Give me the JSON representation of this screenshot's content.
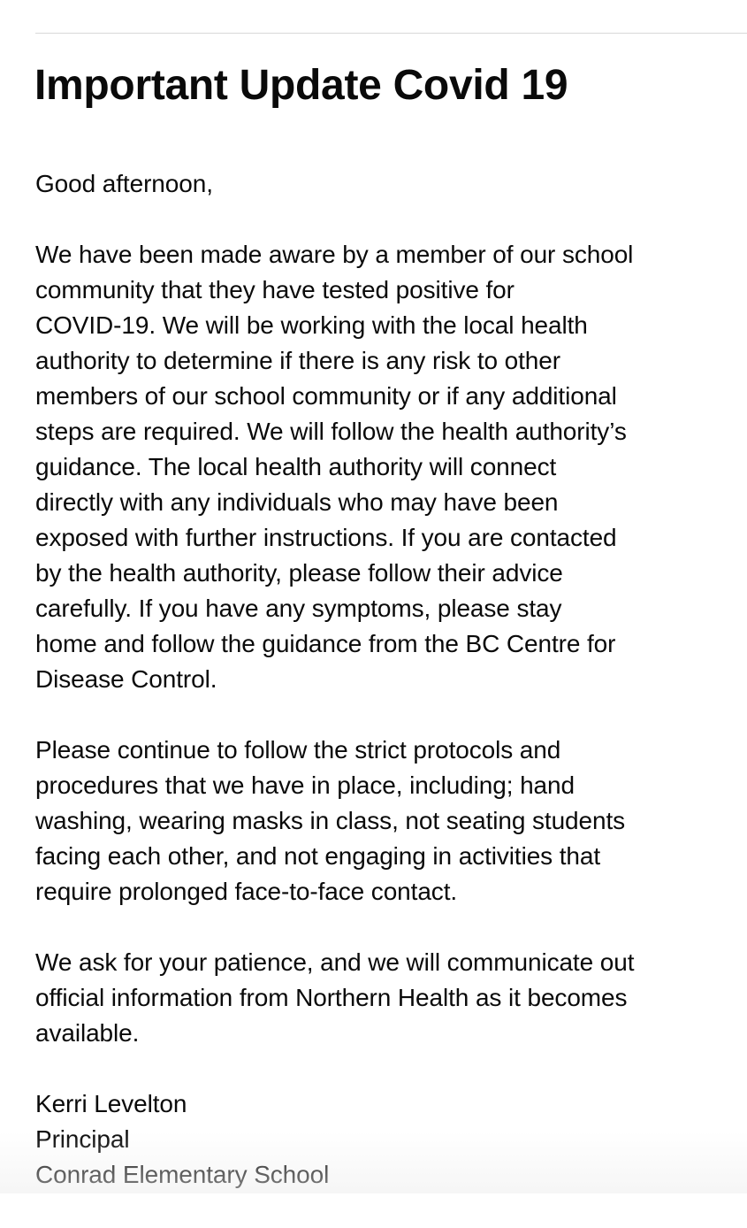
{
  "title": "Important Update Covid 19",
  "greeting": "Good afternoon,",
  "paragraph1": [
    "We have been made aware by a member of our school",
    "community that they have tested positive for",
    "COVID-19.  We will be working with the local health",
    "authority to determine if there is any risk to other",
    "members of our school community or if any additional",
    "steps are required.  We will follow the health authority’s",
    "guidance.  The local health authority will connect",
    "directly with any individuals who may have been",
    "exposed with further instructions.  If you are contacted",
    "by the health authority, please follow their advice",
    "carefully.  If you have any symptoms, please stay",
    "home and follow the guidance from the BC Centre for",
    "Disease Control."
  ],
  "paragraph2": [
    "Please continue to follow the strict protocols and",
    "procedures that we have in place, including; hand",
    "washing, wearing masks in class, not seating students",
    "facing each other, and not engaging in activities that",
    "require prolonged face-to-face contact."
  ],
  "paragraph3": [
    "We ask for your patience, and we will communicate out",
    "official information from Northern Health as it becomes",
    "available."
  ],
  "signature": {
    "name": "Kerri Levelton",
    "role": "Principal",
    "school": "Conrad Elementary School"
  }
}
